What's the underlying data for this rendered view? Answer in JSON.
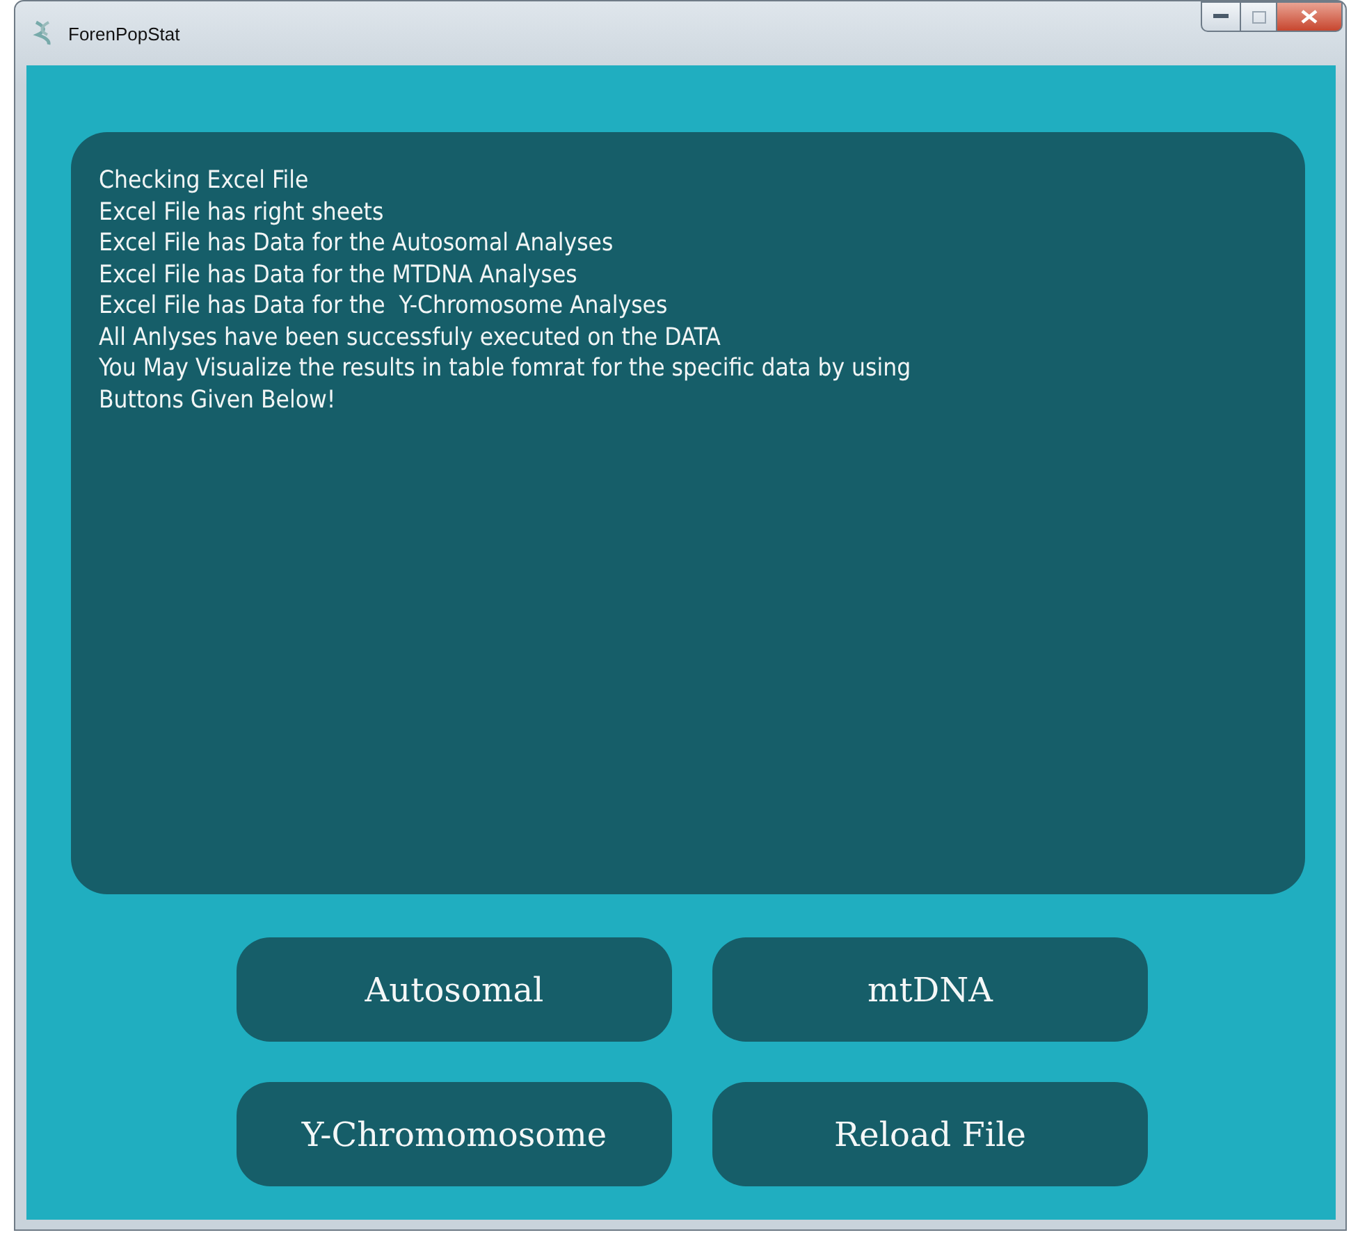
{
  "window": {
    "title": "ForenPopStat"
  },
  "log": {
    "lines": [
      "Checking Excel File",
      "Excel File has right sheets",
      "Excel File has Data for the Autosomal Analyses",
      "Excel File has Data for the MTDNA Analyses",
      "Excel File has Data for the  Y-Chromosome Analyses",
      "All Anlyses have been successfuly executed on the DATA",
      "You May Visualize the results in table fomrat for the specific data by using",
      "Buttons Given Below!"
    ]
  },
  "buttons": [
    "Autosomal",
    "mtDNA",
    "Y-Chromomosome",
    "Reload File"
  ]
}
